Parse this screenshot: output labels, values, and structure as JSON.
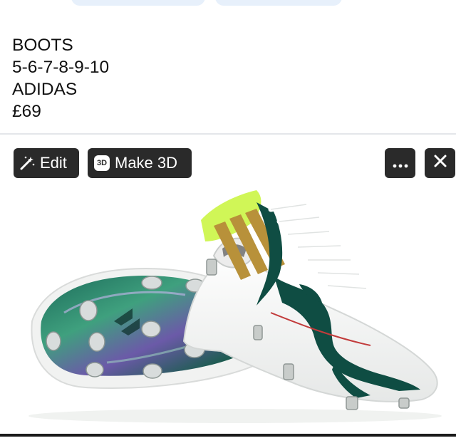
{
  "post": {
    "lines": [
      "BOOTS",
      "5-6-7-8-9-10",
      "ADIDAS",
      "£69"
    ]
  },
  "photo_toolbar": {
    "edit_label": "Edit",
    "make3d_label": "Make 3D",
    "make3d_badge": "3D",
    "edit_icon": "magic-wand-icon",
    "more_icon": "more-horizontal-icon",
    "close_icon": "close-icon"
  },
  "colors": {
    "button_bg": "#2a2a2a",
    "chip_bg": "#e7f0fb",
    "boot_white": "#f4f5f4",
    "boot_green": "#0f4d43",
    "boot_gold": "#b8913a",
    "boot_neon": "#c8f53a"
  }
}
